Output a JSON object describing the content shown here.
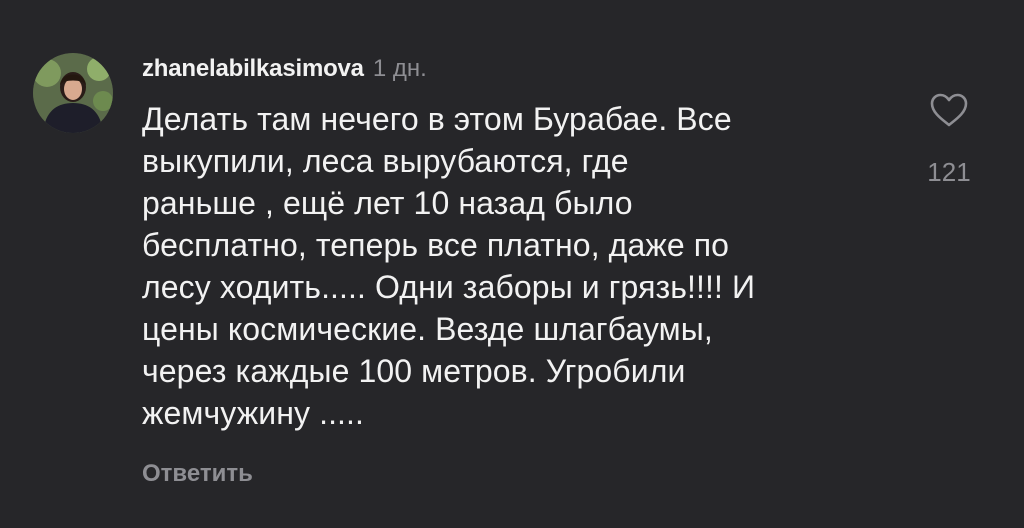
{
  "comment": {
    "username": "zhanelabilkasimova",
    "time": "1 дн.",
    "text_lines": [
      "Делать там нечего в этом Бурабае. Все",
      "выкупили, леса вырубаются, где",
      "раньше , ещё лет 10 назад было",
      "бесплатно, теперь все платно, даже по",
      "лесу ходить..... Одни заборы и грязь!!!! И",
      "цены космические. Везде шлагбаумы,",
      "через каждые 100 метров. Угробили",
      "жемчужину ....."
    ],
    "reply_label": "Ответить",
    "like_icon": "heart-outline-icon",
    "like_count": "121"
  },
  "colors": {
    "background": "#262629",
    "primary_text": "#f2f2f2",
    "secondary_text": "#8e8e93"
  }
}
